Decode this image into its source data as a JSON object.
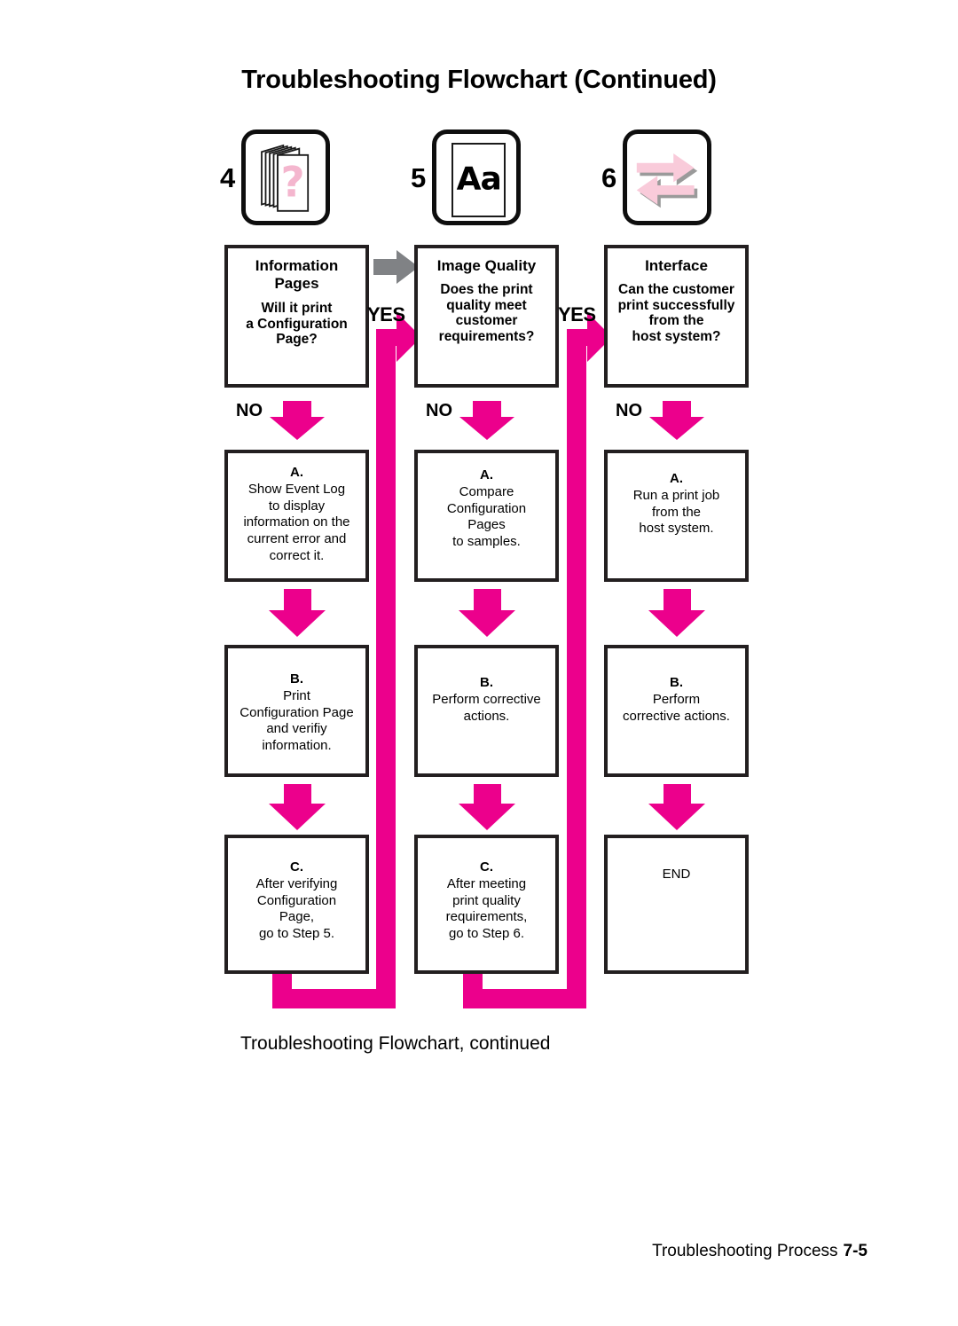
{
  "page": {
    "title": "Troubleshooting Flowchart (Continued)",
    "caption": "Troubleshooting Flowchart, continued",
    "footer_text": "Troubleshooting Process",
    "footer_page": "7-5"
  },
  "colors": {
    "magenta": "#EC008C",
    "gray_arrow": "#808285",
    "box_border": "#231F20",
    "pink_tint": "#F9CBDA"
  },
  "step_icons": [
    {
      "number": "4",
      "icon": "page-stack-question-icon"
    },
    {
      "number": "5",
      "icon": "page-aa-print-quality-icon"
    },
    {
      "number": "6",
      "icon": "bidirectional-arrows-interface-icon"
    }
  ],
  "labels": {
    "yes": "YES",
    "no": "NO"
  },
  "columns": [
    {
      "key": "information-pages",
      "question": {
        "title_line1": "Information",
        "title_line2": "Pages",
        "body_line1": "Will it print",
        "body_line2": "a Configuration",
        "body_line3": "Page?"
      },
      "steps": [
        {
          "letter": "A.",
          "lines": [
            "Show Event Log",
            "to display",
            "information on the",
            "current error and",
            "correct it."
          ]
        },
        {
          "letter": "B.",
          "lines": [
            "Print",
            "Configuration Page",
            "and verifiy",
            "information."
          ]
        },
        {
          "letter": "C.",
          "lines": [
            "After verifying",
            "Configuration",
            "Page,",
            "go to Step 5."
          ]
        }
      ]
    },
    {
      "key": "image-quality",
      "question": {
        "title_line1": "Image Quality",
        "title_line2": "",
        "body_line1": "Does the print",
        "body_line2": "quality meet",
        "body_line3": "customer",
        "body_line4": "requirements?"
      },
      "steps": [
        {
          "letter": "A.",
          "lines": [
            "Compare",
            "Configuration",
            "Pages",
            "to samples."
          ]
        },
        {
          "letter": "B.",
          "lines": [
            "Perform corrective",
            "actions."
          ]
        },
        {
          "letter": "C.",
          "lines": [
            "After meeting",
            "print quality",
            "requirements,",
            "go to Step 6."
          ]
        }
      ]
    },
    {
      "key": "interface",
      "question": {
        "title_line1": "Interface",
        "title_line2": "",
        "body_line1": "Can the customer",
        "body_line2": "print successfully",
        "body_line3": "from the",
        "body_line4": "host system?"
      },
      "steps": [
        {
          "letter": "A.",
          "lines": [
            "Run a print job",
            "from the",
            "host system."
          ]
        },
        {
          "letter": "B.",
          "lines": [
            "Perform",
            "corrective actions."
          ]
        },
        {
          "letter": "END",
          "lines": []
        }
      ]
    }
  ]
}
